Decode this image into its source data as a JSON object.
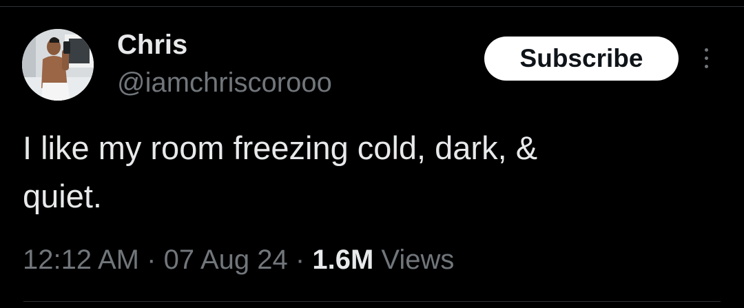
{
  "tweet": {
    "author": {
      "name": "Chris",
      "handle": "@iamchriscorooo"
    },
    "subscribe_label": "Subscribe",
    "more_icon": "more-dots-icon",
    "text_line1": "I like my room freezing cold, dark, &",
    "text_line2": "quiet.",
    "time": "12:12 AM",
    "separator": "·",
    "date": "07 Aug 24",
    "views_count": "1.6M",
    "views_label": "Views"
  },
  "colors": {
    "background": "#000000",
    "primary_text": "#e7e9ea",
    "secondary_text": "#71767b",
    "button_bg": "#ffffff",
    "button_text": "#0f1419",
    "divider": "#2f3336"
  }
}
